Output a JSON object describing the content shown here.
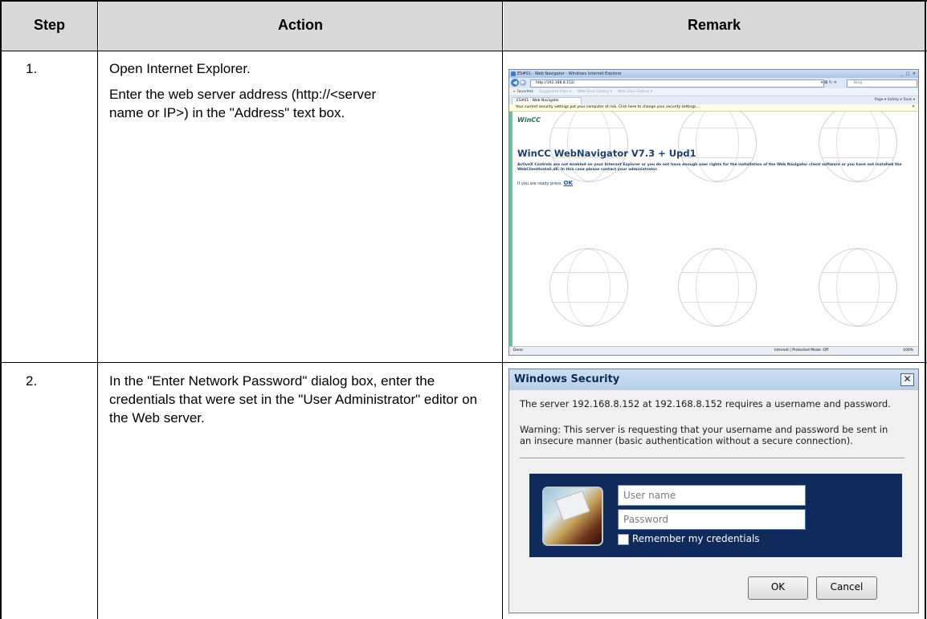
{
  "table": {
    "headers": [
      "Step",
      "Action",
      "Remark"
    ],
    "rows": [
      {
        "step": "1.",
        "action": [
          "Open Internet Explorer.",
          "Enter the web server address (http://<server name or IP>) in the \"Address\" text box."
        ]
      },
      {
        "step": "2.",
        "action": [
          "In the \"Enter Network Password\" dialog box, enter the credentials that were set in the \"User Administrator\" editor on the Web server."
        ]
      }
    ]
  },
  "ie_screenshot": {
    "window_title": "ES#01 - Web Navigator - Windows Internet Explorer",
    "address": "http://192.168.8.152/",
    "search_placeholder": "Bing",
    "favorites": "Favorites",
    "suggested_sites": "Suggested Sites ▾",
    "web_slice_1": "Web Slice Gallery ▾",
    "web_slice_2": "Web Slice Gallery ▾",
    "tab_label": "ES#01 - Web Navigator",
    "command_bar": "Page ▾  Safety ▾  Tools ▾",
    "info_bar": "Your current security settings put your computer at risk. Click here to change your security settings...",
    "logo": "WinCC",
    "page_title": "WinCC WebNavigator V7.3 + Upd1",
    "page_message": "ActiveX Controls are not enabled on your Internet Explorer or you do not have enough user rights for the installation of the Web Navigator client software or you have not installed the WebClientInstall.dll. In this case please contact your administrator.",
    "ready_text": "If you are ready press",
    "ok_link": "OK",
    "status_left": "Done",
    "status_zone": "Internet | Protected Mode: Off",
    "zoom": "100%"
  },
  "security_dialog": {
    "title": "Windows Security",
    "line1": "The server 192.168.8.152 at 192.168.8.152 requires a username and password.",
    "line2": "Warning: This server is requesting that your username and password be sent in",
    "line3": "an insecure manner (basic authentication without a secure connection).",
    "username_placeholder": "User name",
    "password_placeholder": "Password",
    "remember_label": "Remember my credentials",
    "ok_label": "OK",
    "cancel_label": "Cancel"
  }
}
